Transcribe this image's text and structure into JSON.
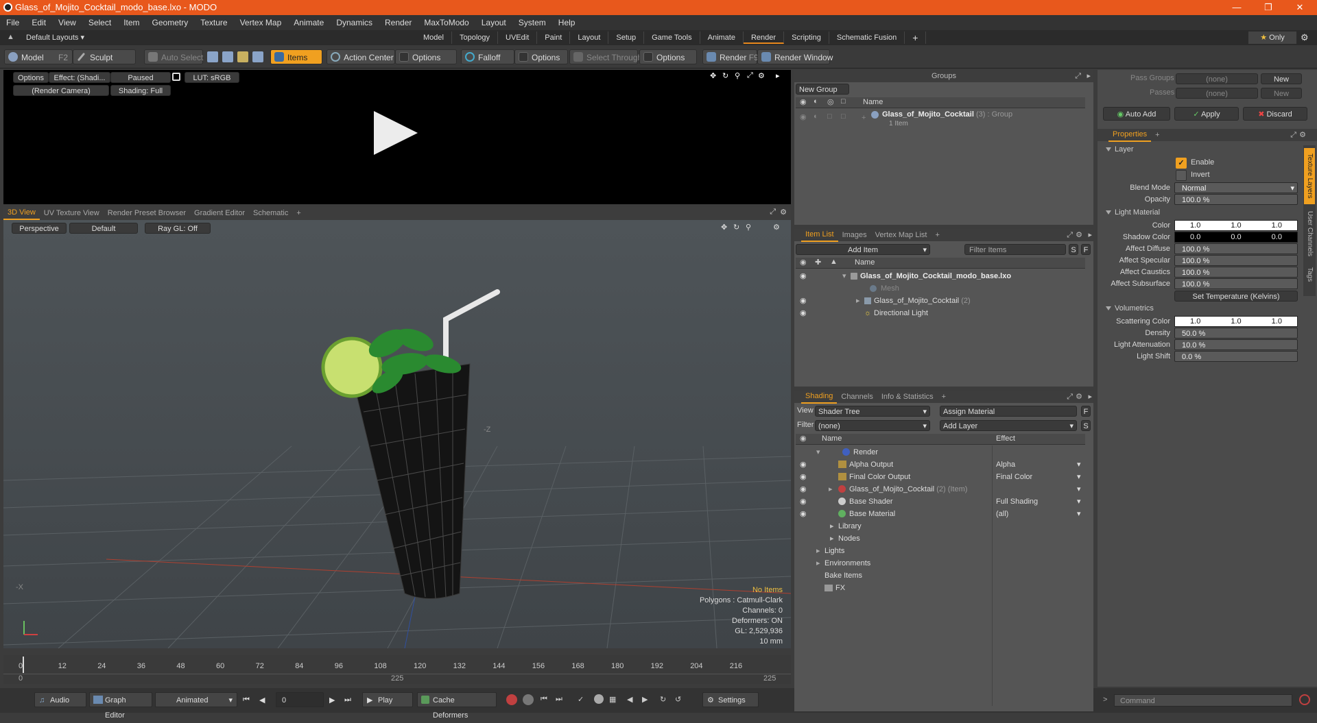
{
  "titlebar": {
    "title": "Glass_of_Mojito_Cocktail_modo_base.lxo - MODO"
  },
  "menu": [
    "File",
    "Edit",
    "View",
    "Select",
    "Item",
    "Geometry",
    "Texture",
    "Vertex Map",
    "Animate",
    "Dynamics",
    "Render",
    "MaxToModo",
    "Layout",
    "System",
    "Help"
  ],
  "layout": {
    "default_layouts": "Default Layouts",
    "tabs": [
      "Model",
      "Topology",
      "UVEdit",
      "Paint",
      "Layout",
      "Setup",
      "Game Tools",
      "Animate",
      "Render",
      "Scripting",
      "Schematic Fusion"
    ],
    "active_tab": "Render",
    "only_label": "Only"
  },
  "toolbar": {
    "model": "Model",
    "model_key": "F2",
    "sculpt": "Sculpt",
    "auto_select": "Auto Select",
    "items": "Items",
    "action_center": "Action Center",
    "options1": "Options",
    "falloff": "Falloff",
    "options2": "Options",
    "select_through": "Select Through",
    "options3": "Options",
    "render": "Render",
    "render_key": "F9",
    "render_window": "Render Window"
  },
  "render_view": {
    "options": "Options",
    "effect": "Effect: (Shadi...",
    "paused": "Paused",
    "lut": "LUT: sRGB",
    "camera": "(Render Camera)",
    "shading": "Shading: Full"
  },
  "viewport": {
    "tabs": [
      "3D View",
      "UV Texture View",
      "Render Preset Browser",
      "Gradient Editor",
      "Schematic"
    ],
    "active_tab": "3D View",
    "perspective": "Perspective",
    "default": "Default",
    "raygl": "Ray GL: Off",
    "axis_z": "-Z",
    "axis_x": "-X",
    "stats": {
      "no_items": "No Items",
      "polygons": "Polygons : Catmull-Clark",
      "channels": "Channels: 0",
      "deformers": "Deformers: ON",
      "gl": "GL: 2,529,936",
      "scale": "10 mm"
    }
  },
  "timeline": {
    "ticks": [
      "0",
      "12",
      "24",
      "36",
      "48",
      "60",
      "72",
      "84",
      "96",
      "108",
      "120",
      "132",
      "144",
      "156",
      "168",
      "180",
      "192",
      "204",
      "216"
    ],
    "start": "0",
    "mid": "225",
    "end": "225"
  },
  "bottombar": {
    "audio": "Audio",
    "graph_editor": "Graph Editor",
    "animated": "Animated",
    "frame": "0",
    "play": "Play",
    "cache_deformers": "Cache Deformers",
    "settings": "Settings",
    "command_placeholder": "Command"
  },
  "groups": {
    "title": "Groups",
    "new_group": "New Group",
    "col_name": "Name",
    "item_name": "Glass_of_Mojito_Cocktail",
    "item_count": "(3)",
    "item_type": ": Group",
    "item_sub": "1 Item"
  },
  "itemlist": {
    "tabs": [
      "Item List",
      "Images",
      "Vertex Map List"
    ],
    "add_item": "Add Item",
    "filter_items": "Filter Items",
    "s": "S",
    "f": "F",
    "col_name": "Name",
    "rows": [
      {
        "label": "Glass_of_Mojito_Cocktail_modo_base.lxo",
        "extra": ""
      },
      {
        "label": "Mesh",
        "extra": ""
      },
      {
        "label": "Glass_of_Mojito_Cocktail",
        "extra": "(2)"
      },
      {
        "label": "Directional Light",
        "extra": ""
      }
    ]
  },
  "shading": {
    "tabs": [
      "Shading",
      "Channels",
      "Info & Statistics"
    ],
    "view_label": "View",
    "view_value": "Shader Tree",
    "assign_material": "Assign Material",
    "filter_label": "Filter",
    "filter_value": "(none)",
    "add_layer": "Add Layer",
    "col_name": "Name",
    "col_effect": "Effect",
    "rows": [
      {
        "label": "Render",
        "effect": "",
        "extra": ""
      },
      {
        "label": "Alpha Output",
        "effect": "Alpha",
        "extra": ""
      },
      {
        "label": "Final Color Output",
        "effect": "Final Color",
        "extra": ""
      },
      {
        "label": "Glass_of_Mojito_Cocktail",
        "effect": "",
        "extra": "(2) (Item)"
      },
      {
        "label": "Base Shader",
        "effect": "Full Shading",
        "extra": ""
      },
      {
        "label": "Base Material",
        "effect": "(all)",
        "extra": ""
      },
      {
        "label": "Library",
        "effect": "",
        "extra": ""
      },
      {
        "label": "Nodes",
        "effect": "",
        "extra": ""
      },
      {
        "label": "Lights",
        "effect": "",
        "extra": ""
      },
      {
        "label": "Environments",
        "effect": "",
        "extra": ""
      },
      {
        "label": "Bake Items",
        "effect": "",
        "extra": ""
      },
      {
        "label": "FX",
        "effect": "",
        "extra": ""
      }
    ]
  },
  "passes": {
    "pass_groups": "Pass Groups",
    "passes": "Passes",
    "none1": "(none)",
    "none2": "(none)",
    "new1": "New",
    "new2": "New",
    "auto_add": "Auto Add",
    "apply": "Apply",
    "discard": "Discard"
  },
  "properties": {
    "tab": "Properties",
    "layer_section": "Layer",
    "enable": "Enable",
    "invert": "Invert",
    "blend_mode_label": "Blend Mode",
    "blend_mode": "Normal",
    "opacity_label": "Opacity",
    "opacity": "100.0 %",
    "light_material_section": "Light Material",
    "color_label": "Color",
    "color": [
      "1.0",
      "1.0",
      "1.0"
    ],
    "shadow_color_label": "Shadow Color",
    "shadow_color": [
      "0.0",
      "0.0",
      "0.0"
    ],
    "affect_diffuse_label": "Affect Diffuse",
    "affect_diffuse": "100.0 %",
    "affect_specular_label": "Affect Specular",
    "affect_specular": "100.0 %",
    "affect_caustics_label": "Affect Caustics",
    "affect_caustics": "100.0 %",
    "affect_subsurface_label": "Affect Subsurface",
    "affect_subsurface": "100.0 %",
    "set_temperature": "Set Temperature (Kelvins)",
    "volumetrics_section": "Volumetrics",
    "scattering_color_label": "Scattering Color",
    "scattering_color": [
      "1.0",
      "1.0",
      "1.0"
    ],
    "density_label": "Density",
    "density": "50.0 %",
    "light_attenuation_label": "Light Attenuation",
    "light_attenuation": "10.0 %",
    "light_shift_label": "Light Shift",
    "light_shift": "0.0 %",
    "side_tabs": [
      "Texture Layers",
      "User Channels",
      "Tags"
    ]
  },
  "colors": {
    "accent": "#f0a020",
    "title": "#e8581c"
  }
}
